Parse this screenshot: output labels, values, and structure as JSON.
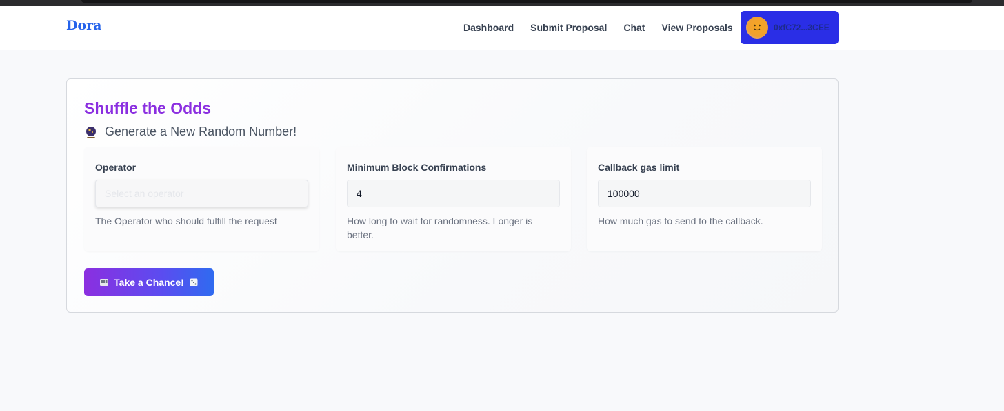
{
  "navbar": {
    "brand": "Dora",
    "links": [
      "Dashboard",
      "Submit Proposal",
      "Chat",
      "View Proposals"
    ],
    "wallet": {
      "address": "0xfC72...3CEE",
      "button_color": "#2a2ee6"
    }
  },
  "card": {
    "title": "Shuffle the Odds",
    "subtitle_icon": "crystal-ball-icon",
    "subtitle": "Generate a New Random Number!",
    "fields": [
      {
        "label": "Operator",
        "value": "",
        "placeholder": "Select an operator",
        "help": "The Operator who should fulfill the request"
      },
      {
        "label": "Minimum Block Confirmations",
        "value": "4",
        "placeholder": "",
        "help": "How long to wait for randomness. Longer is better."
      },
      {
        "label": "Callback gas limit",
        "value": "100000",
        "placeholder": "",
        "help": "How much gas to send to the callback."
      }
    ],
    "button": {
      "label": "Take a Chance!",
      "icon_left": "slot-machine-icon",
      "icon_right": "dice-icon"
    }
  },
  "colors": {
    "brand": "#2563eb",
    "title": "#8b2fe0",
    "button_gradient_start": "#8b2fe0",
    "button_gradient_end": "#2f6bf0"
  }
}
